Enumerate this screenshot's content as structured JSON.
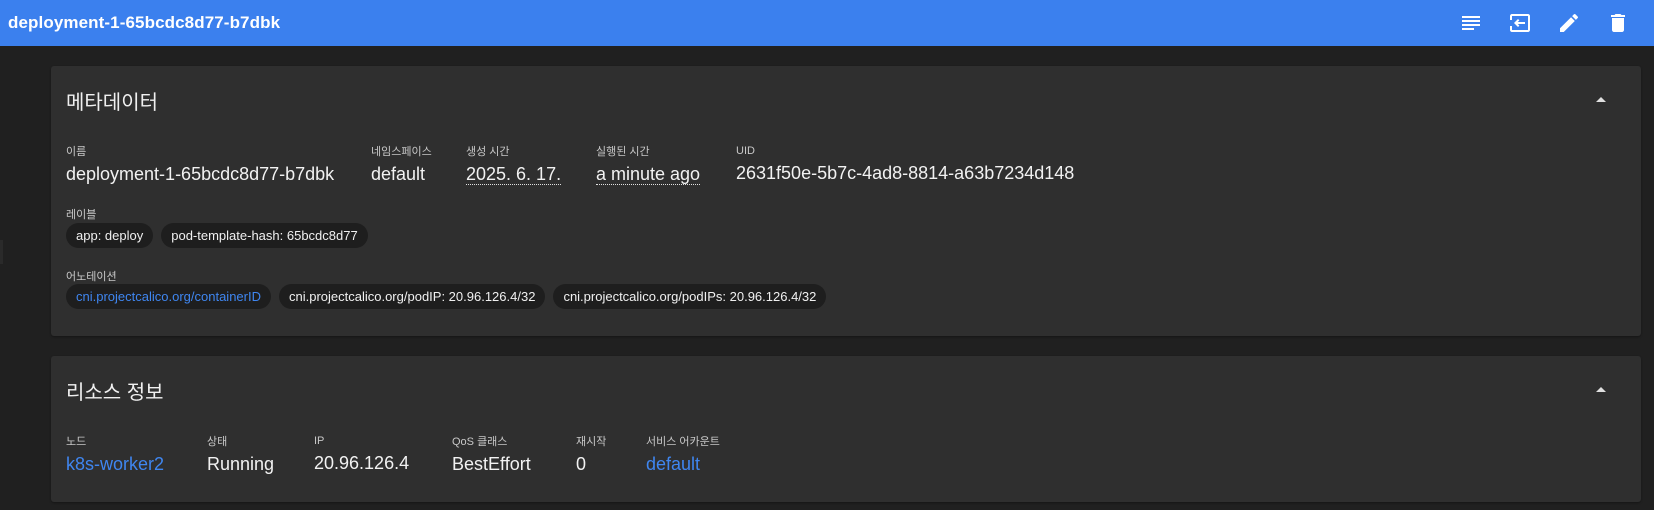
{
  "header": {
    "title": "deployment-1-65bcdc8d77-b7dbk",
    "icons": [
      "logs-icon",
      "exec-icon",
      "edit-icon",
      "delete-icon"
    ],
    "color": "#3b80ee"
  },
  "metadata": {
    "title": "메타데이터",
    "name_label": "이름",
    "name_value": "deployment-1-65bcdc8d77-b7dbk",
    "namespace_label": "네임스페이스",
    "namespace_value": "default",
    "created_label": "생성 시간",
    "created_value": "2025. 6. 17.",
    "started_label": "실행된 시간",
    "started_value": "a minute ago",
    "uid_label": "UID",
    "uid_value": "2631f50e-5b7c-4ad8-8814-a63b7234d148",
    "labels_label": "레이블",
    "labels": [
      "app: deploy",
      "pod-template-hash: 65bcdc8d77"
    ],
    "annotations_label": "어노테이션",
    "annotations": [
      "cni.projectcalico.org/containerID",
      "cni.projectcalico.org/podIP: 20.96.126.4/32",
      "cni.projectcalico.org/podIPs: 20.96.126.4/32"
    ]
  },
  "resource": {
    "title": "리소스 정보",
    "node_label": "노드",
    "node_value": "k8s-worker2",
    "status_label": "상태",
    "status_value": "Running",
    "ip_label": "IP",
    "ip_value": "20.96.126.4",
    "qos_label": "QoS 클래스",
    "qos_value": "BestEffort",
    "restart_label": "재시작",
    "restart_value": "0",
    "sa_label": "서비스 어카운트",
    "sa_value": "default"
  },
  "colors": {
    "link": "#3f86f0",
    "card": "#2f2f2f",
    "background": "#202020"
  }
}
